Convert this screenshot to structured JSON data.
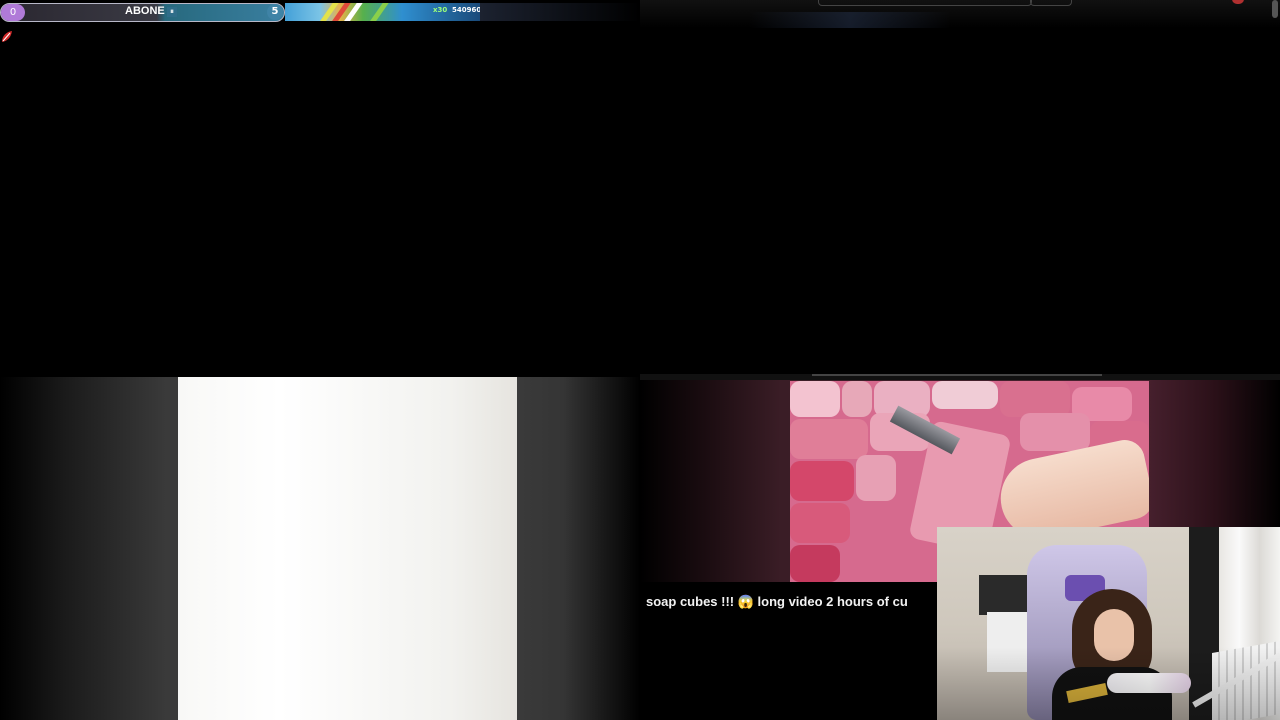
{
  "subscriber_goal": {
    "current": "0",
    "label": "ABONE",
    "pause_icon": "pause-icon",
    "goal": "5",
    "progress": 0.0
  },
  "game": {
    "multiplier": "x30",
    "score": "540960"
  },
  "video": {
    "title": "soap cubes !!! 😱 long video 2 hours of cu"
  },
  "colors": {
    "goal_accent": "#b07ad8",
    "goal_bar": "#3a7fa0",
    "soap_pink": "#d66a8e",
    "logo_red": "#d22b2b"
  },
  "icons": {
    "logo": "red-leaf-logo-icon",
    "pause": "pause-icon"
  }
}
